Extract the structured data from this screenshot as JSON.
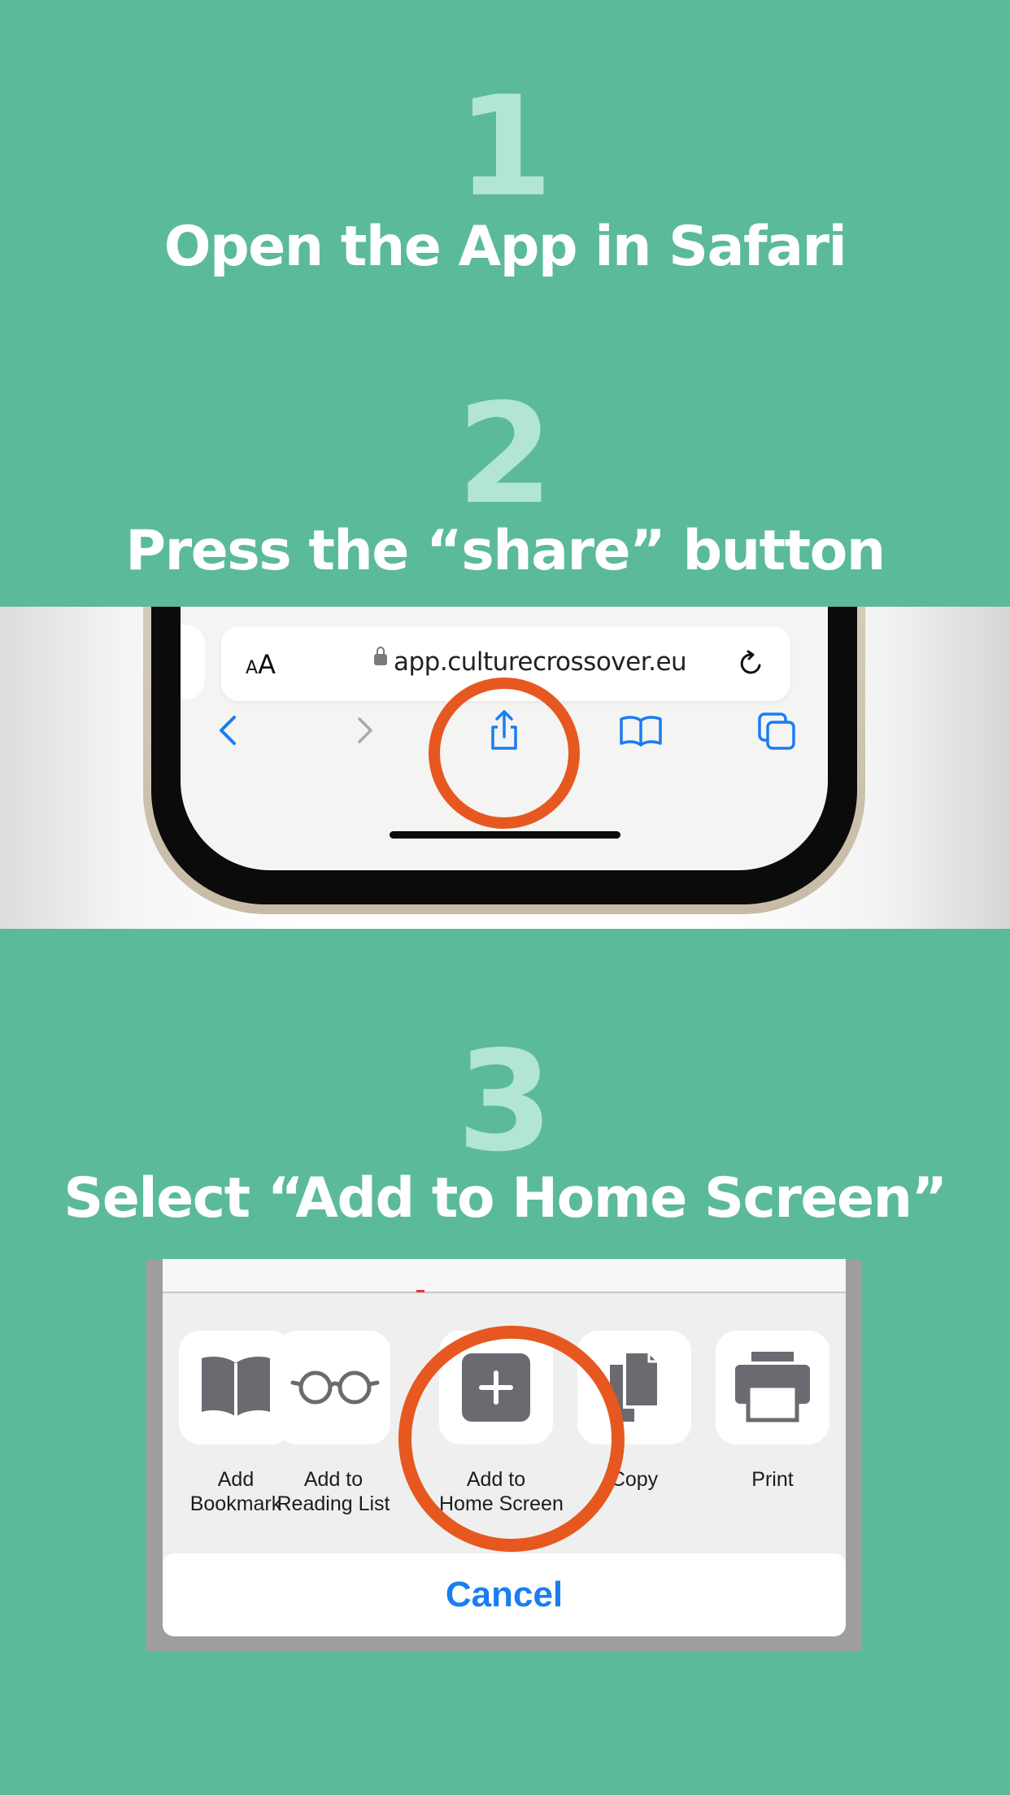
{
  "step1": {
    "number": "1",
    "title": "Open the App in Safari"
  },
  "step2": {
    "number": "2",
    "title": "Press the “share” button",
    "browser": {
      "text_size_label_small": "A",
      "text_size_label_large": "A",
      "url": "app.culturecrossover.eu",
      "icons": [
        "back-icon",
        "forward-icon",
        "share-icon",
        "bookmarks-icon",
        "tabs-icon",
        "reload-icon",
        "lock-icon"
      ]
    },
    "highlight_color": "#e65820"
  },
  "step3": {
    "number": "3",
    "title": "Select “Add to Home Screen”",
    "actions": [
      {
        "icon": "book-icon",
        "line1": "Add",
        "line2": "Bookmark"
      },
      {
        "icon": "glasses-icon",
        "line1": "Add to",
        "line2": "Reading List"
      },
      {
        "icon": "plus-square-icon",
        "line1": "Add to",
        "line2": "Home Screen"
      },
      {
        "icon": "copy-icon",
        "line1": "Copy",
        "line2": ""
      },
      {
        "icon": "print-icon",
        "line1": "Print",
        "line2": ""
      }
    ],
    "cancel_label": "Cancel"
  },
  "colors": {
    "background": "#5bba9a",
    "number": "#b2e5d2",
    "title": "#ffffff",
    "ios_blue": "#1a7df2",
    "highlight": "#e65820"
  }
}
